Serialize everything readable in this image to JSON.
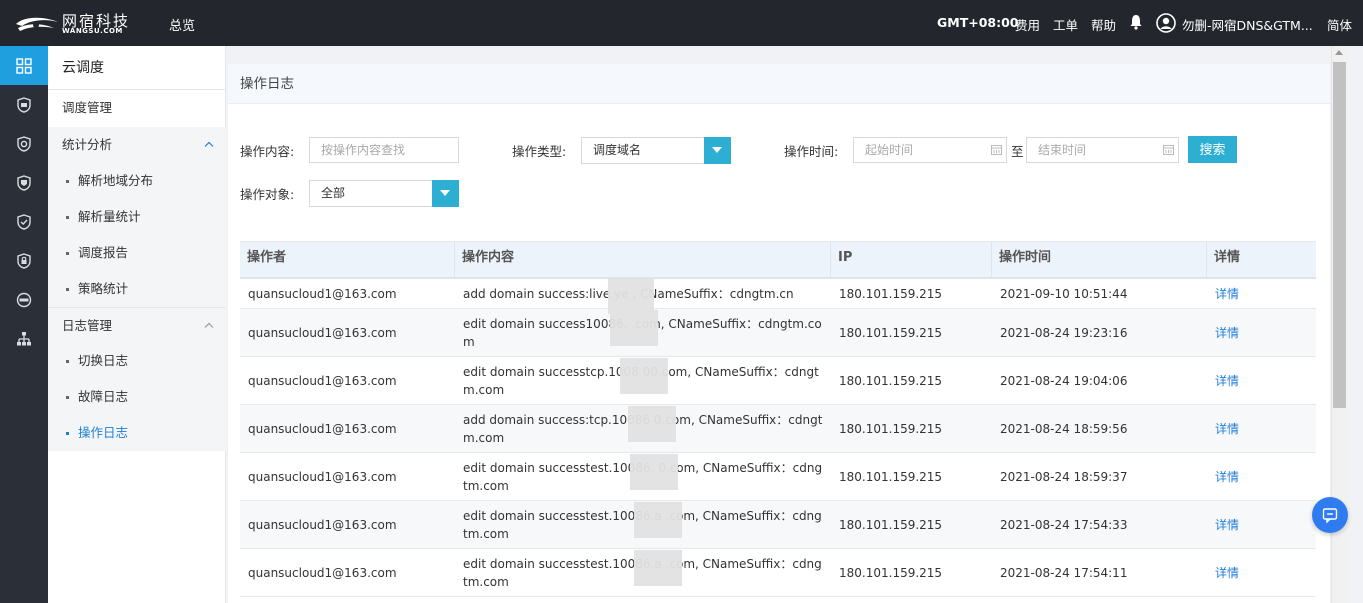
{
  "topbar": {
    "logo_cn": "网宿科技",
    "logo_en": "WANGSU.COM",
    "overview": "总览",
    "timezone": "GMT+08:00",
    "fee": "费用",
    "ticket": "工单",
    "help": "帮助",
    "user": "勿删-网宿DNS&GTM...",
    "lang": "简体"
  },
  "rail": {
    "icons": [
      "grid-icon",
      "shield-icon",
      "shield-circle-icon",
      "shield-badge-icon",
      "shield-check-icon",
      "shield-lock-icon",
      "dns-icon",
      "org-chart-icon"
    ]
  },
  "sidebar": {
    "title": "云调度",
    "items": {
      "dispatch_mgmt": "调度管理",
      "stats": "统计分析",
      "geo": "解析地域分布",
      "volume": "解析量统计",
      "report": "调度报告",
      "policy": "策略统计",
      "log_mgmt": "日志管理",
      "switch_log": "切换日志",
      "fault_log": "故障日志",
      "op_log": "操作日志"
    }
  },
  "panel": {
    "title": "操作日志"
  },
  "filters": {
    "content_label": "操作内容:",
    "content_placeholder": "按操作内容查找",
    "type_label": "操作类型:",
    "type_value": "调度域名",
    "time_label": "操作时间:",
    "start_placeholder": "起始时间",
    "to": "至",
    "end_placeholder": "结束时间",
    "search": "搜索",
    "target_label": "操作对象:",
    "target_value": "全部"
  },
  "table": {
    "headers": {
      "operator": "操作者",
      "content": "操作内容",
      "ip": "IP",
      "time": "操作时间",
      "detail": "详情"
    },
    "rows": [
      {
        "operator": "quansucloud1@163.com",
        "content": "add domain success:live.ye         , CNameSuffix：cdngtm.cn",
        "ip": "180.101.159.215",
        "time": "2021-09-10 10:51:44",
        "detail": "详情"
      },
      {
        "operator": "quansucloud1@163.com",
        "content": "edit domain success10086.          .com, CNameSuffix：cdngtm.com",
        "ip": "180.101.159.215",
        "time": "2021-08-24 19:23:16",
        "detail": "详情"
      },
      {
        "operator": "quansucloud1@163.com",
        "content": "edit domain successtcp.1008          00.com, CNameSuffix：cdngtm.com",
        "ip": "180.101.159.215",
        "time": "2021-08-24 19:04:06",
        "detail": "详情"
      },
      {
        "operator": "quansucloud1@163.com",
        "content": "add domain success:tcp.10086          0.com, CNameSuffix：cdngtm.com",
        "ip": "180.101.159.215",
        "time": "2021-08-24 18:59:56",
        "detail": "详情"
      },
      {
        "operator": "quansucloud1@163.com",
        "content": "edit domain successtest.10086.          0.com, CNameSuffix：cdngtm.com",
        "ip": "180.101.159.215",
        "time": "2021-08-24 18:59:37",
        "detail": "详情"
      },
      {
        "operator": "quansucloud1@163.com",
        "content": "edit domain successtest.10086.a          .com, CNameSuffix：cdngtm.com",
        "ip": "180.101.159.215",
        "time": "2021-08-24 17:54:33",
        "detail": "详情"
      },
      {
        "operator": "quansucloud1@163.com",
        "content": "edit domain successtest.10086.a          .com, CNameSuffix：cdngtm.com",
        "ip": "180.101.159.215",
        "time": "2021-08-24 17:54:11",
        "detail": "详情"
      }
    ]
  },
  "colors": {
    "topbar": "#23272d",
    "rail": "#2b3038",
    "accent": "#2dafd4",
    "link": "#1f7fd6",
    "active_rail": "#1f9fe0"
  }
}
